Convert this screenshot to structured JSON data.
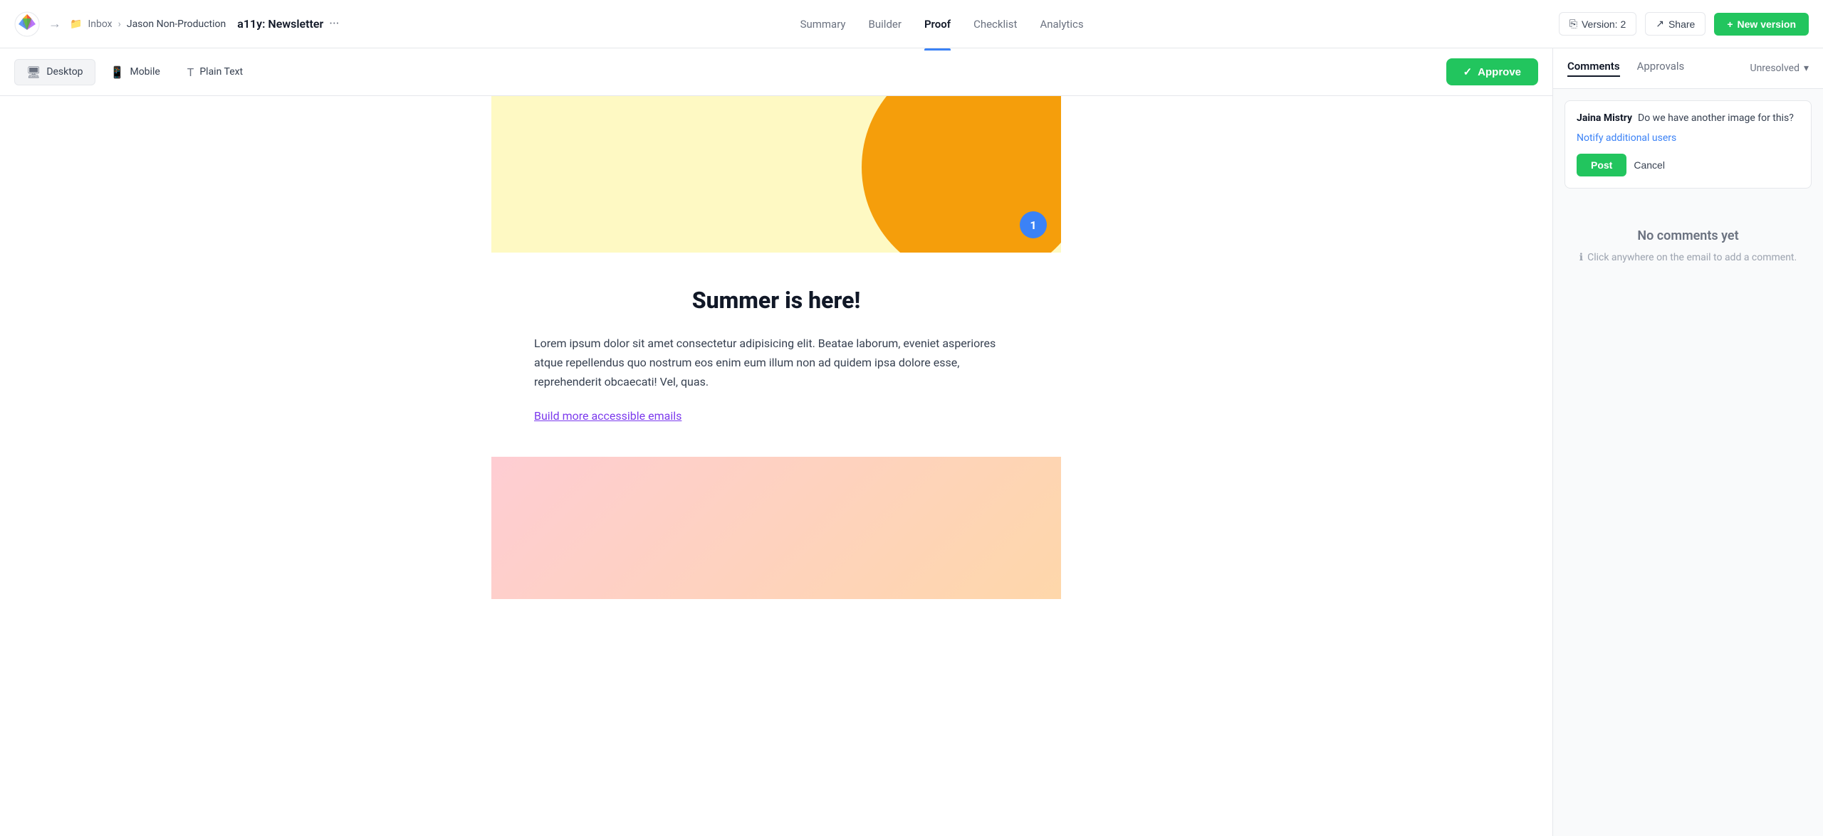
{
  "app": {
    "logo_alt": "Litmus logo"
  },
  "breadcrumb": {
    "inbox": "Inbox",
    "workspace": "Jason Non-Production"
  },
  "document": {
    "title": "a11y: Newsletter",
    "more_label": "···"
  },
  "nav": {
    "links": [
      {
        "label": "Summary",
        "active": false
      },
      {
        "label": "Builder",
        "active": false
      },
      {
        "label": "Proof",
        "active": true
      },
      {
        "label": "Checklist",
        "active": false
      },
      {
        "label": "Analytics",
        "active": false
      }
    ],
    "version_label": "Version: 2",
    "share_label": "Share",
    "new_version_label": "New version"
  },
  "toolbar": {
    "views": [
      {
        "label": "Desktop",
        "icon": "desktop",
        "active": true
      },
      {
        "label": "Mobile",
        "icon": "mobile",
        "active": false
      },
      {
        "label": "Plain Text",
        "icon": "text",
        "active": false
      }
    ],
    "approve_label": "Approve"
  },
  "email_preview": {
    "heading": "Summer is here!",
    "body_text": "Lorem ipsum dolor sit amet consectetur adipisicing elit. Beatae laborum, eveniet asperiores atque repellendus quo nostrum eos enim eum illum non ad quidem ipsa dolore esse, reprehenderit obcaecati! Vel, quas.",
    "link_text": "Build more accessible emails",
    "comment_pin_number": "1"
  },
  "sidebar": {
    "tabs": [
      {
        "label": "Comments",
        "active": true
      },
      {
        "label": "Approvals",
        "active": false
      }
    ],
    "status_label": "Unresolved",
    "comment": {
      "author": "Jaina Mistry",
      "text": "Do we have another image for this?",
      "notify_label": "Notify additional users",
      "post_label": "Post",
      "cancel_label": "Cancel"
    },
    "no_comments_title": "No comments yet",
    "no_comments_hint": "Click anywhere on the email to add a comment."
  }
}
